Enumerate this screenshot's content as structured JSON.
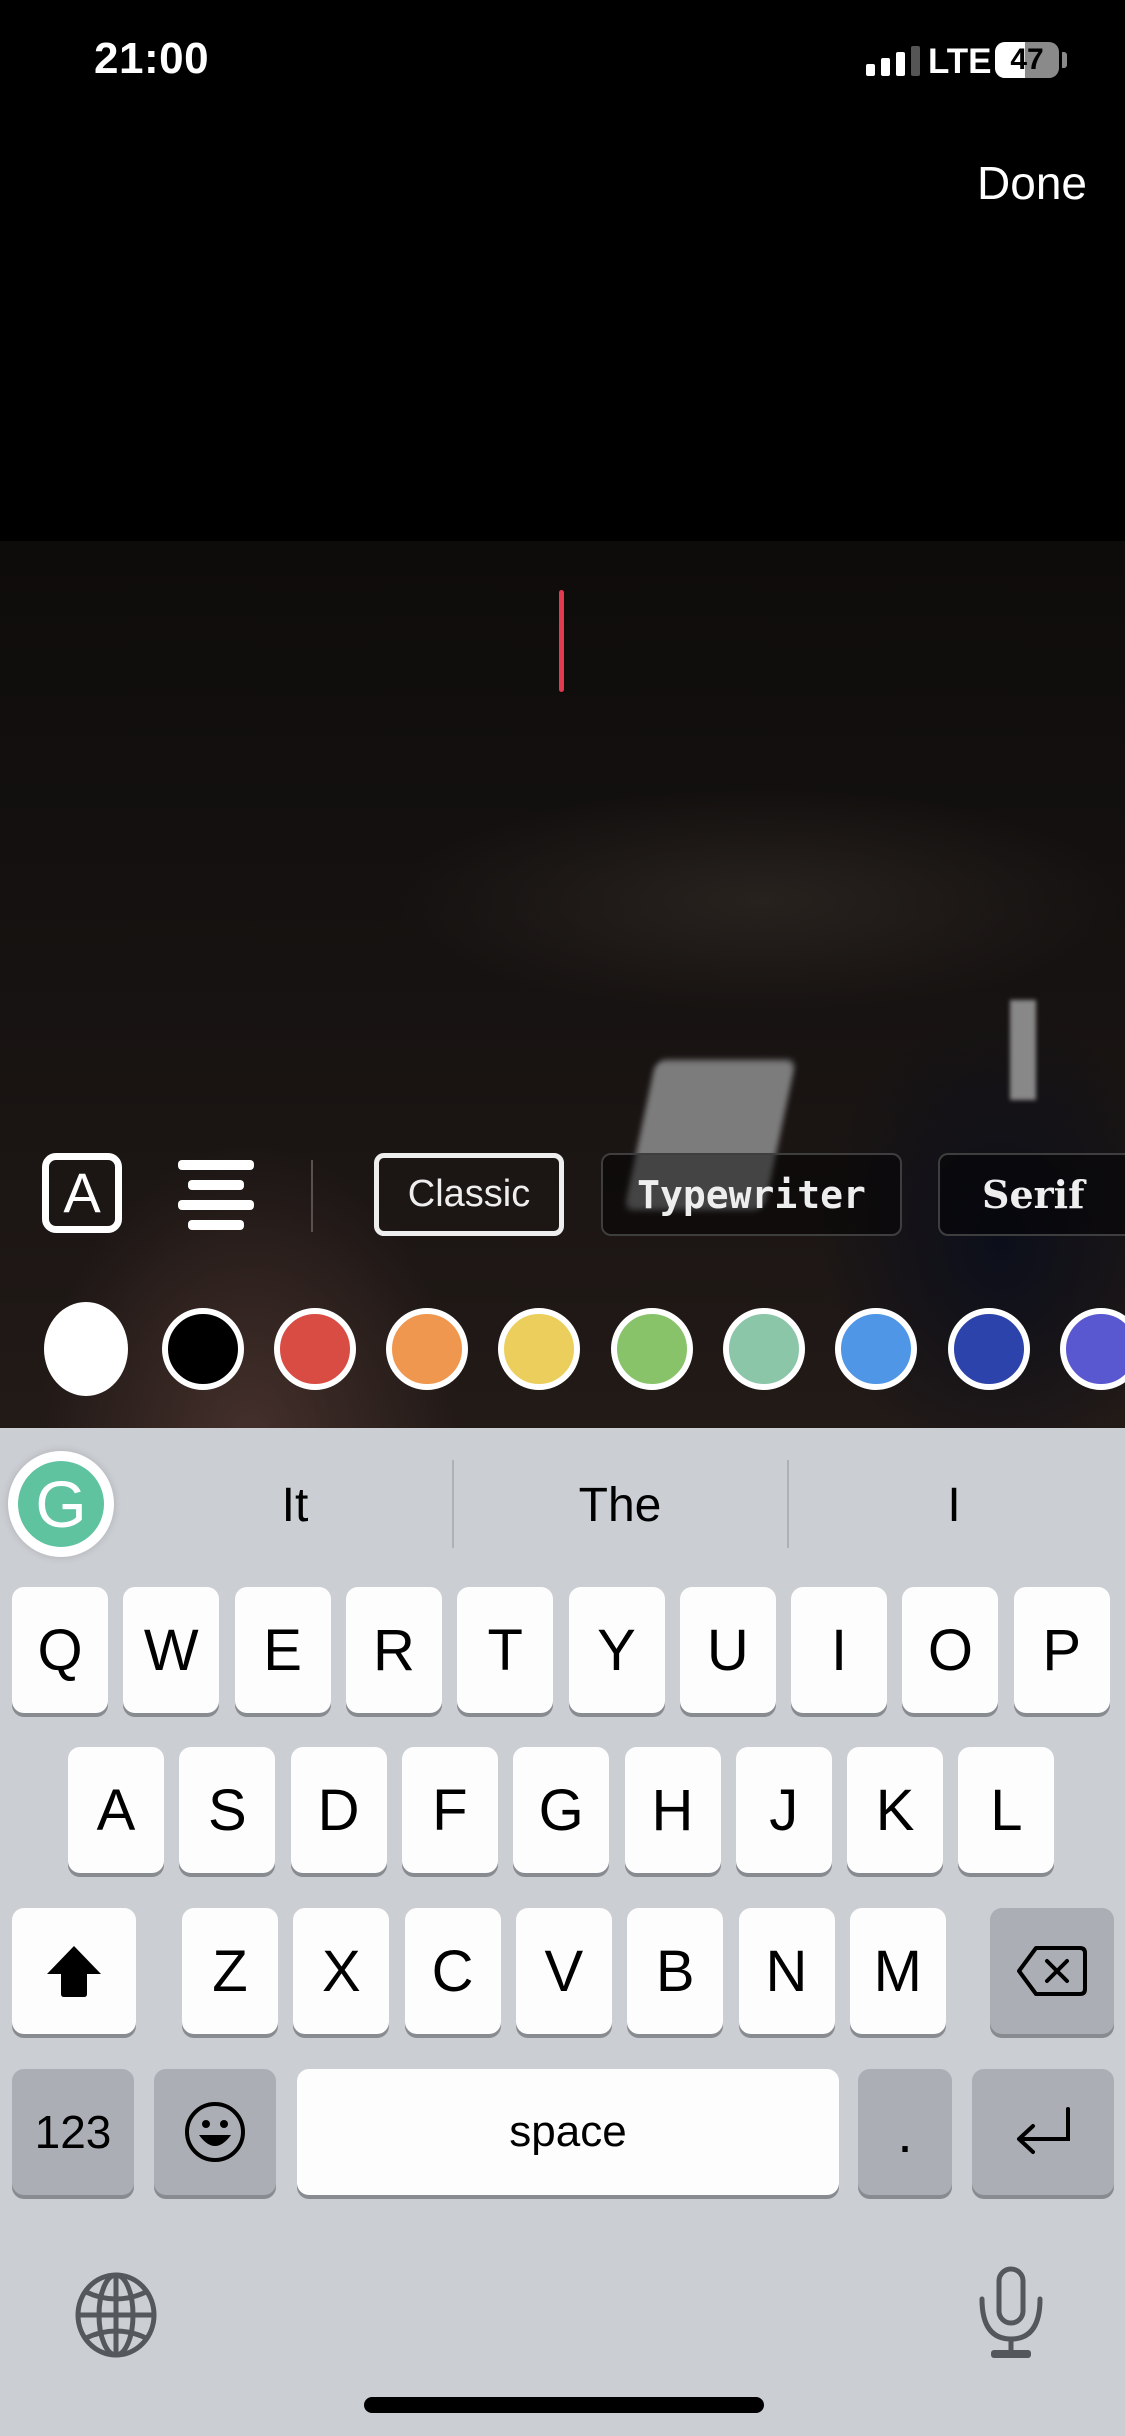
{
  "status_bar": {
    "time": "21:00",
    "network": "LTE",
    "battery_level": "47",
    "battery_fraction": 0.47,
    "signal_bars_active": 3,
    "signal_bars_total": 4
  },
  "header": {
    "done_label": "Done"
  },
  "editor": {
    "text_value": "",
    "cursor_color": "#e23a4e"
  },
  "toolbar": {
    "text_style_icon_label": "A",
    "align_icon": "align-center-icon",
    "fonts": [
      {
        "label": "Classic",
        "selected": true
      },
      {
        "label": "Typewriter",
        "selected": false
      },
      {
        "label": "Serif",
        "selected": false
      }
    ]
  },
  "colors": [
    {
      "name": "white",
      "hex": "#ffffff",
      "selected": true
    },
    {
      "name": "black",
      "hex": "#000000",
      "selected": false
    },
    {
      "name": "red",
      "hex": "#d94c44",
      "selected": false
    },
    {
      "name": "orange",
      "hex": "#ef974f",
      "selected": false
    },
    {
      "name": "yellow",
      "hex": "#ecce5c",
      "selected": false
    },
    {
      "name": "green",
      "hex": "#88c36a",
      "selected": false
    },
    {
      "name": "mint",
      "hex": "#8bc6a9",
      "selected": false
    },
    {
      "name": "light-blue",
      "hex": "#5096e6",
      "selected": false
    },
    {
      "name": "dark-blue",
      "hex": "#2c43ab",
      "selected": false
    },
    {
      "name": "purple",
      "hex": "#5a58d0",
      "selected": false
    }
  ],
  "keyboard": {
    "grammarly_label": "G",
    "suggestions": [
      "It",
      "The",
      "I"
    ],
    "row1": [
      "Q",
      "W",
      "E",
      "R",
      "T",
      "Y",
      "U",
      "I",
      "O",
      "P"
    ],
    "row2": [
      "A",
      "S",
      "D",
      "F",
      "G",
      "H",
      "J",
      "K",
      "L"
    ],
    "row3": [
      "Z",
      "X",
      "C",
      "V",
      "B",
      "N",
      "M"
    ],
    "numbers_label": "123",
    "space_label": "space",
    "period_label": "."
  }
}
